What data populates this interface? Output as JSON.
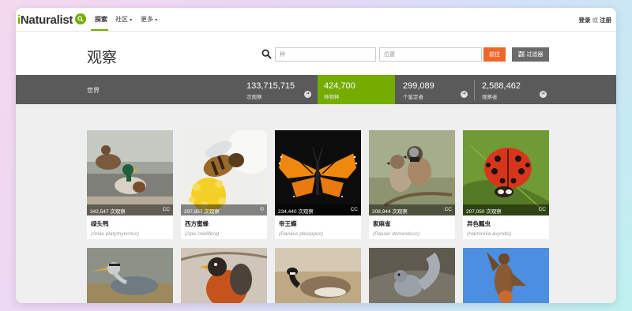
{
  "brand": {
    "logo_prefix": "i",
    "logo_rest": "Naturalist",
    "accent": "#74ac00"
  },
  "nav": {
    "items": [
      {
        "label": "探索",
        "caret": false
      },
      {
        "label": "社区",
        "caret": true
      },
      {
        "label": "更多",
        "caret": true
      }
    ],
    "auth": {
      "login": "登录",
      "sep": "或",
      "signup": "注册"
    }
  },
  "header": {
    "title": "观察",
    "species_placeholder": "种",
    "location_placeholder": "位置",
    "go_label": "前往",
    "filter_label": "过滤器"
  },
  "stats": {
    "place": "世界",
    "items": [
      {
        "value": "133,715,715",
        "label": "次观察"
      },
      {
        "value": "424,700",
        "label": "种物种"
      },
      {
        "value": "299,089",
        "label": "个鉴定者"
      },
      {
        "value": "2,588,462",
        "label": "观察者"
      }
    ]
  },
  "cards": [
    {
      "count": "342,547 次观察",
      "license": "CC",
      "common": "绿头鸭",
      "scientific": "(Anas platyrhynchos)"
    },
    {
      "count": "297,857 次观察",
      "license": "©",
      "common": "西方蜜蜂",
      "scientific": "(Apis mellifera)"
    },
    {
      "count": "234,440 次观察",
      "license": "CC",
      "common": "帝王蝶",
      "scientific": "(Danaus plexippus)"
    },
    {
      "count": "208,944 次观察",
      "license": "CC",
      "common": "家麻雀",
      "scientific": "(Passer domesticus)"
    },
    {
      "count": "207,050 次观察",
      "license": "CC",
      "common": "异色瓢虫",
      "scientific": "(Harmonia axyridis)"
    }
  ],
  "icons": [
    "search-icon",
    "sliders-icon",
    "arrow-right-icon",
    "chevron-down-icon"
  ]
}
